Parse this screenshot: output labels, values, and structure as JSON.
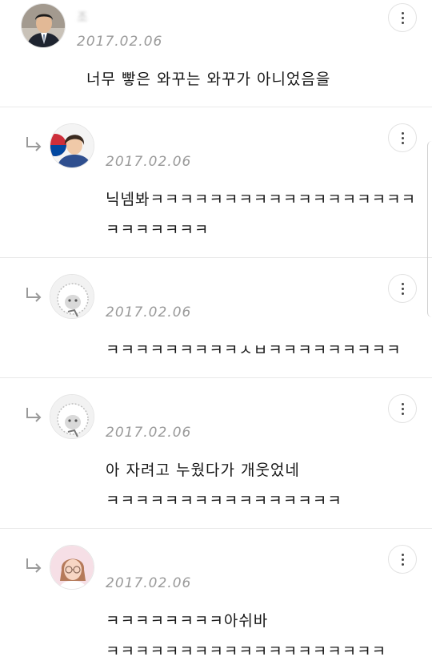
{
  "comments": [
    {
      "author": "조",
      "date": "2017.02.06",
      "avatar": "man-in-suit-avatar",
      "lines": [
        "너무 빻은 와꾸는 와꾸가 아니었음을"
      ]
    },
    {
      "author": "",
      "date": "2017.02.06",
      "avatar": "woman-with-flag-avatar",
      "lines": [
        "닉넴봐ㅋㅋㅋㅋㅋㅋㅋㅋㅋㅋㅋㅋㅋㅋㅋㅋㅋㅋ",
        "ㅋㅋㅋㅋㅋㅋㅋ"
      ]
    },
    {
      "author": "",
      "date": "2017.02.06",
      "avatar": "default-character-avatar",
      "lines": [
        "ㅋㅋㅋㅋㅋㅋㅋㅋㅋㅅㅂㅋㅋㅋㅋㅋㅋㅋㅋㅋ"
      ]
    },
    {
      "author": "",
      "date": "2017.02.06",
      "avatar": "default-character-avatar",
      "lines": [
        "아 자려고 누웠다가 개웃었네",
        "ㅋㅋㅋㅋㅋㅋㅋㅋㅋㅋㅋㅋㅋㅋㅋㅋ"
      ]
    },
    {
      "author": "",
      "date": "2017.02.06",
      "avatar": "girl-with-glasses-avatar",
      "lines": [
        "ㅋㅋㅋㅋㅋㅋㅋㅋ아쉬바",
        "ㅋㅋㅋㅋㅋㅋㅋㅋㅋㅋㅋㅋㅋㅋㅋㅋㅋㅋㅋ"
      ]
    }
  ],
  "icons": {
    "more": "more-vertical-icon",
    "reply": "reply-arrow-icon"
  },
  "colors": {
    "text": "#161616",
    "date": "#9a9a9a",
    "divider": "#e9e9e9",
    "flag_red": "#cd2e3a",
    "flag_blue": "#0047a0"
  }
}
